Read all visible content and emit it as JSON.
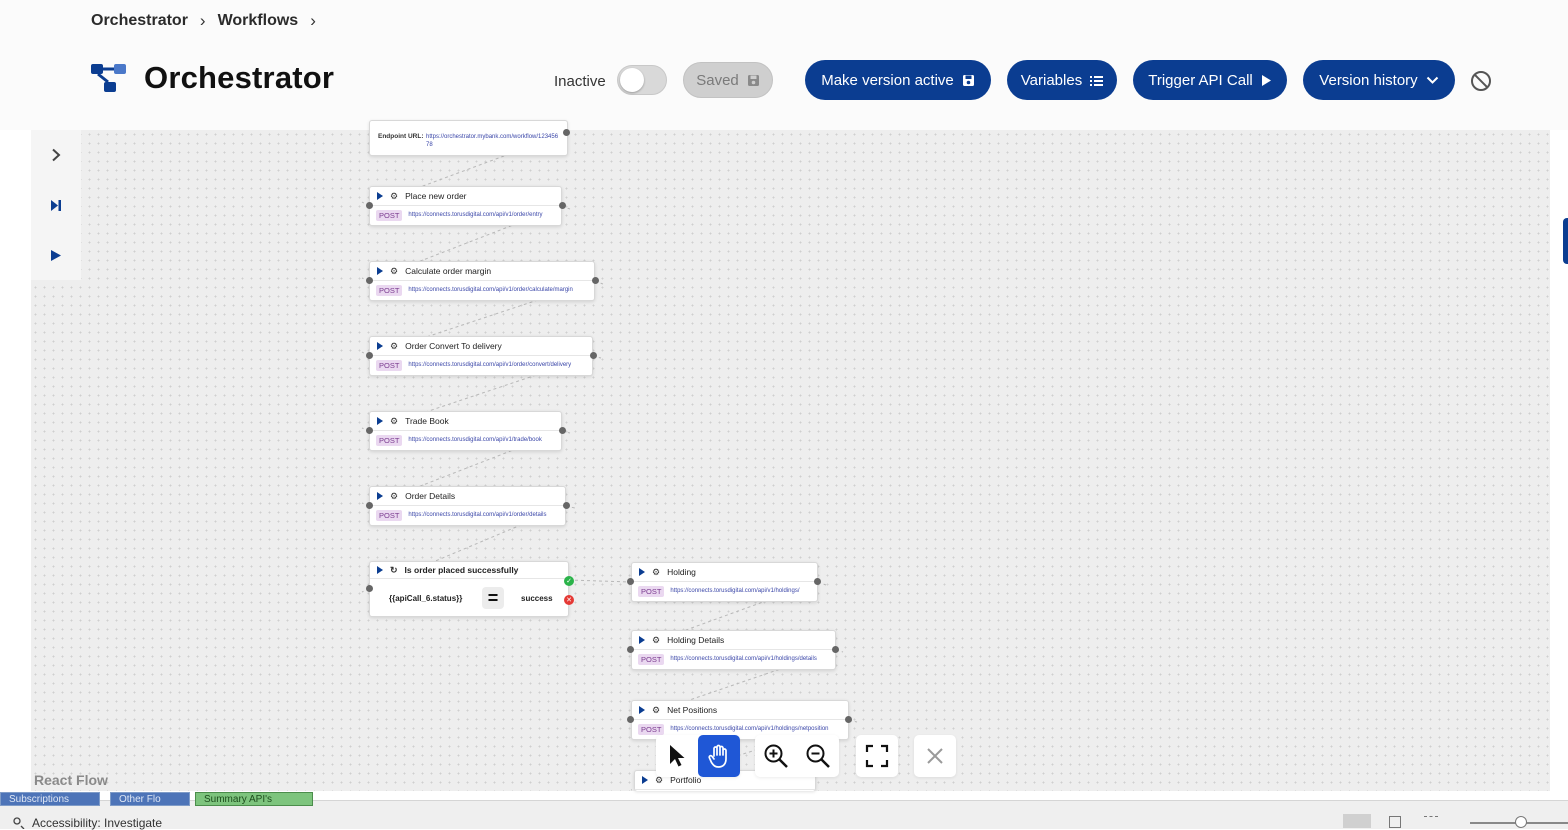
{
  "breadcrumb": {
    "items": [
      "Orchestrator",
      "Workflows"
    ]
  },
  "header": {
    "title": "Orchestrator",
    "status_label": "Inactive",
    "saved_label": "Saved",
    "buttons": {
      "make_active": "Make version active",
      "variables": "Variables",
      "trigger": "Trigger API Call",
      "history": "Version history"
    }
  },
  "colors": {
    "primary": "#0b3d91",
    "post_badge_bg": "#ead8f0",
    "success": "#2bb34a",
    "fail": "#e53935"
  },
  "endpoint_node": {
    "label": "Endpoint URL:",
    "url": "https://orchestrator.mybank.com/workflow/12345678"
  },
  "nodes": [
    {
      "id": "place-new-order",
      "title": "Place new order",
      "method": "POST",
      "url": "https://connects.torusdigital.com/api/v1/order/entry"
    },
    {
      "id": "calculate-order-margin",
      "title": "Calculate order margin",
      "method": "POST",
      "url": "https://connects.torusdigital.com/api/v1/order/calculate/margin"
    },
    {
      "id": "order-convert-to-delivery",
      "title": "Order Convert To delivery",
      "method": "POST",
      "url": "https://connects.torusdigital.com/api/v1/order/convert/delivery"
    },
    {
      "id": "trade-book",
      "title": "Trade Book",
      "method": "POST",
      "url": "https://connects.torusdigital.com/api/v1/trade/book"
    },
    {
      "id": "order-details",
      "title": "Order Details",
      "method": "POST",
      "url": "https://connects.torusdigital.com/api/v1/order/details"
    },
    {
      "id": "holding",
      "title": "Holding",
      "method": "POST",
      "url": "https://connects.torusdigital.com/api/v1/holdings/"
    },
    {
      "id": "holding-details",
      "title": "Holding Details",
      "method": "POST",
      "url": "https://connects.torusdigital.com/api/v1/holdings/details"
    },
    {
      "id": "net-positions",
      "title": "Net Positions",
      "method": "POST",
      "url": "https://connects.torusdigital.com/api/v1/holdings/netposition"
    },
    {
      "id": "portfolio",
      "title": "Portfolio",
      "method": "",
      "url": ""
    }
  ],
  "condition_node": {
    "title": "Is order placed successfully",
    "expression": "{{apiCall_6.status}}",
    "operator": "=",
    "value": "success"
  },
  "canvas": {
    "attribution": "React Flow"
  },
  "ide": {
    "tabs": [
      "Subscriptions",
      "Other Flo",
      "Summary API's"
    ],
    "status": "Accessibility: Investigate"
  }
}
